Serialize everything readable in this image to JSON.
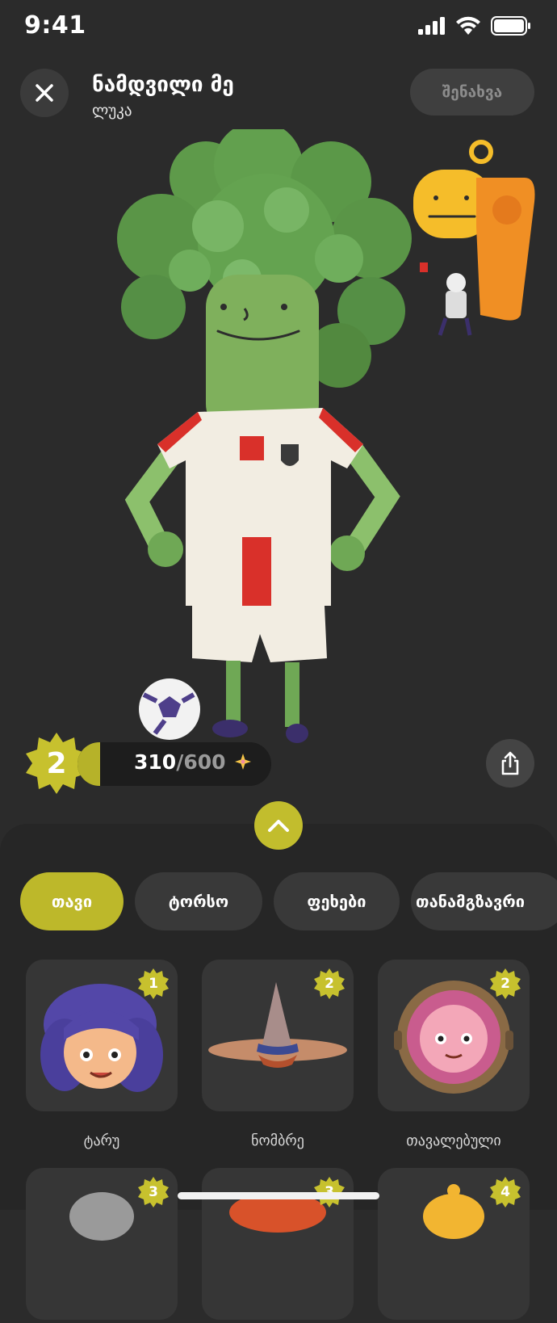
{
  "status_bar": {
    "time": "9:41"
  },
  "header": {
    "title": "ნამდვილი მე",
    "subtitle": "ლუკა",
    "save_label": "შენახვა"
  },
  "level": {
    "number": "2",
    "xp_current": "310",
    "xp_separator": "/",
    "xp_total": "600",
    "xp_fraction": 0.5167
  },
  "tabs": [
    {
      "label": "თავი",
      "active": true
    },
    {
      "label": "ტორსო",
      "active": false
    },
    {
      "label": "ფეხები",
      "active": false
    },
    {
      "label": "თანამგზავრი",
      "active": false
    }
  ],
  "items": [
    {
      "label": "ტარუ",
      "level": "1"
    },
    {
      "label": "ნომბრე",
      "level": "2"
    },
    {
      "label": "თავალებული",
      "level": "2"
    },
    {
      "label": "",
      "level": "3"
    },
    {
      "label": "",
      "level": "3"
    },
    {
      "label": "",
      "level": "4"
    }
  ],
  "colors": {
    "accent": "#bdb82a",
    "background": "#2b2b2b",
    "sheet": "#262626"
  },
  "icons": {
    "close": "close-icon",
    "share": "share-icon",
    "expand": "chevron-up-icon",
    "sparkle": "sparkle-icon"
  }
}
